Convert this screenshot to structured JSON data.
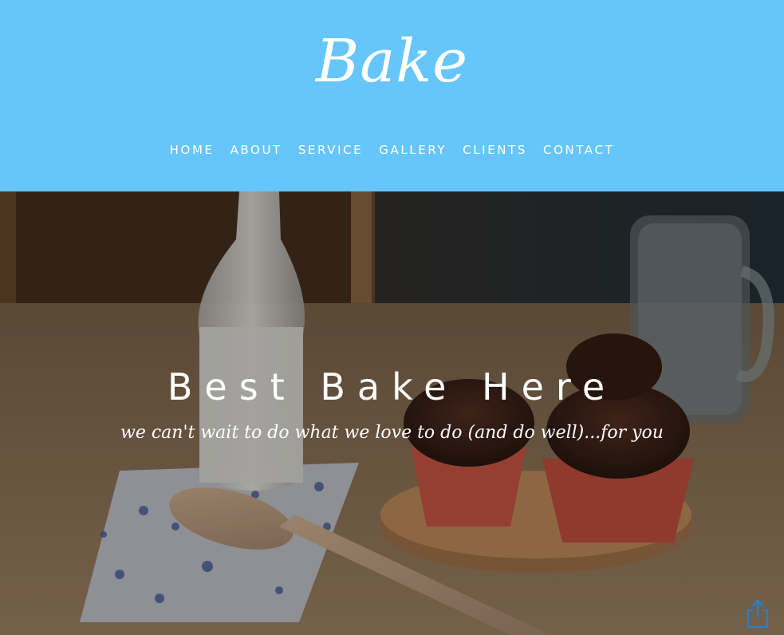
{
  "header": {
    "logo_text": "Bake",
    "background_color": "#66c6fc",
    "nav": [
      {
        "label": "HOME"
      },
      {
        "label": "ABOUT"
      },
      {
        "label": "SERVICE"
      },
      {
        "label": "GALLERY"
      },
      {
        "label": "CLIENTS"
      },
      {
        "label": "CONTACT"
      }
    ]
  },
  "hero": {
    "title": "Best Bake Here",
    "subtitle": "we can't wait to do what we love to do (and do well)...for you",
    "image_description_icon": "cupcakes-milk-photo"
  },
  "share_icon": "share-icon",
  "colors": {
    "accent": "#66c6fc",
    "text_light": "#ffffff",
    "share_icon": "#2a7fc8"
  }
}
